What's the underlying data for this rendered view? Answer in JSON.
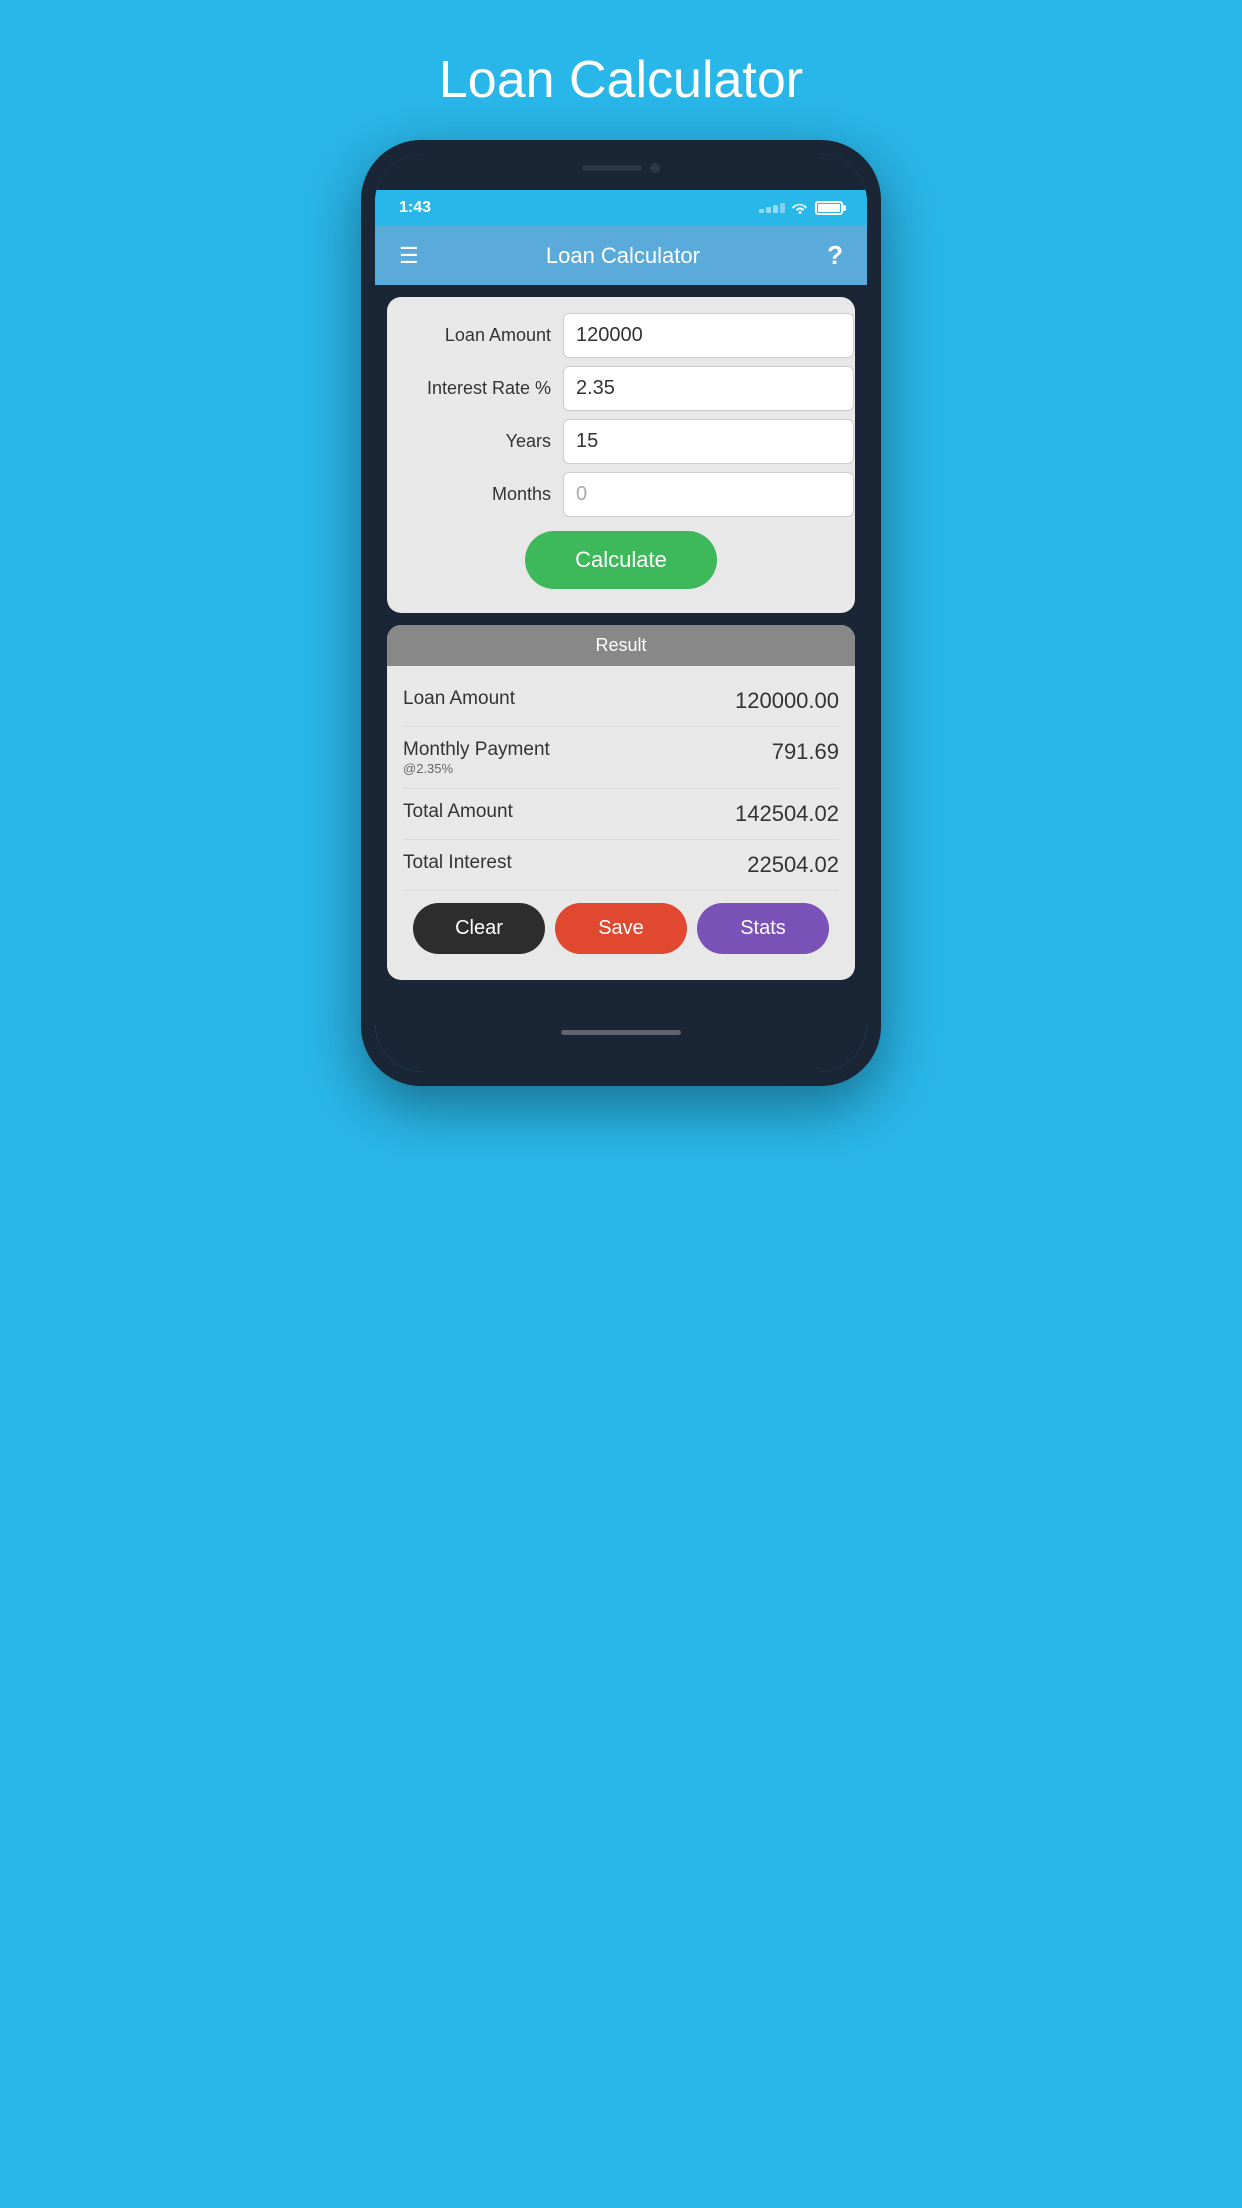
{
  "page": {
    "title": "Loan Calculator",
    "background_color": "#29b6e8"
  },
  "status_bar": {
    "time": "1:43",
    "signal": "dots",
    "wifi": true,
    "battery": "full"
  },
  "nav": {
    "title": "Loan Calculator",
    "menu_label": "☰",
    "help_label": "?"
  },
  "input_form": {
    "fields": [
      {
        "label": "Loan Amount",
        "value": "120000",
        "placeholder": ""
      },
      {
        "label": "Interest Rate %",
        "value": "2.35",
        "placeholder": ""
      },
      {
        "label": "Years",
        "value": "15",
        "placeholder": ""
      },
      {
        "label": "Months",
        "value": "",
        "placeholder": "0"
      }
    ],
    "calculate_button": "Calculate"
  },
  "result": {
    "header": "Result",
    "rows": [
      {
        "label": "Loan Amount",
        "sublabel": "",
        "value": "120000.00"
      },
      {
        "label": "Monthly Payment",
        "sublabel": "@2.35%",
        "value": "791.69"
      },
      {
        "label": "Total Amount",
        "sublabel": "",
        "value": "142504.02"
      },
      {
        "label": "Total Interest",
        "sublabel": "",
        "value": "22504.02"
      }
    ],
    "buttons": {
      "clear": "Clear",
      "save": "Save",
      "stats": "Stats"
    }
  }
}
